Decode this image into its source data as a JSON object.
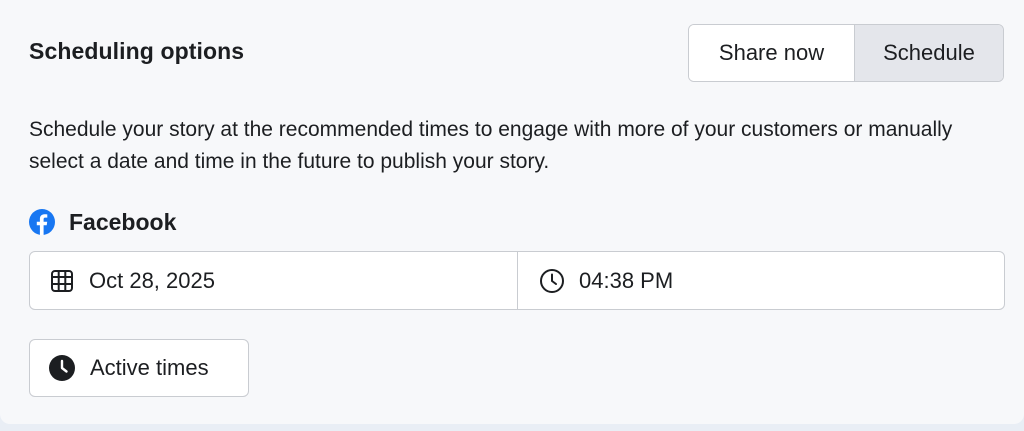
{
  "section": {
    "title": "Scheduling options",
    "description": "Schedule your story at the recommended times to engage with more of your customers or manually select a date and time in the future to publish your story."
  },
  "mode_toggle": {
    "share_now_label": "Share now",
    "schedule_label": "Schedule",
    "selected": "Schedule"
  },
  "platform": {
    "icon": "facebook-icon",
    "label": "Facebook",
    "brand_color": "#1877f2"
  },
  "datetime": {
    "date_icon": "calendar-icon",
    "date_value": "Oct 28, 2025",
    "time_icon": "clock-icon",
    "time_value": "04:38 PM"
  },
  "active_times": {
    "icon": "clock-filled-icon",
    "label": "Active times"
  }
}
